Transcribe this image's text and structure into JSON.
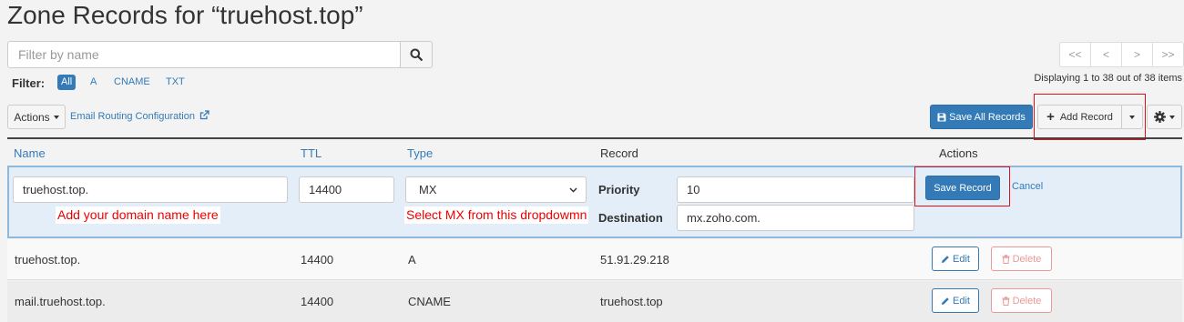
{
  "page": {
    "title": "Zone Records for “truehost.top”"
  },
  "search": {
    "placeholder": "Filter by name",
    "value": ""
  },
  "filter": {
    "label": "Filter:",
    "options": [
      {
        "label": "All",
        "active": true
      },
      {
        "label": "A"
      },
      {
        "label": "CNAME"
      },
      {
        "label": "TXT"
      }
    ]
  },
  "pagination": {
    "first": "<<",
    "prev": "<",
    "next": ">",
    "last": ">>",
    "summary": "Displaying 1 to 38 out of 38 items"
  },
  "toolbar": {
    "actions_label": "Actions",
    "email_routing_label": "Email Routing Configuration",
    "save_all_label": "Save All Records",
    "add_record_label": "Add Record"
  },
  "table": {
    "headers": {
      "name": "Name",
      "ttl": "TTL",
      "type": "Type",
      "record": "Record",
      "actions": "Actions"
    },
    "edit_row": {
      "name_value": "truehost.top.",
      "ttl_value": "14400",
      "type_value": "MX",
      "priority_label": "Priority",
      "priority_value": "10",
      "destination_label": "Destination",
      "destination_value": "mx.zoho.com.",
      "save_label": "Save Record",
      "cancel_label": "Cancel",
      "name_hint": "Add your domain name here",
      "type_hint": "Select MX from this dropdowmn"
    },
    "rows": [
      {
        "name": "truehost.top.",
        "ttl": "14400",
        "type": "A",
        "record": "51.91.29.218",
        "edit": "Edit",
        "delete": "Delete"
      },
      {
        "name": "mail.truehost.top.",
        "ttl": "14400",
        "type": "CNAME",
        "record": "truehost.top",
        "edit": "Edit",
        "delete": "Delete"
      }
    ]
  },
  "colors": {
    "primary": "#337ab7",
    "danger_outline": "#e89a98",
    "highlight_box": "#d9151b",
    "edit_row_bg": "#e3eef8",
    "hint_text": "#e00000"
  }
}
